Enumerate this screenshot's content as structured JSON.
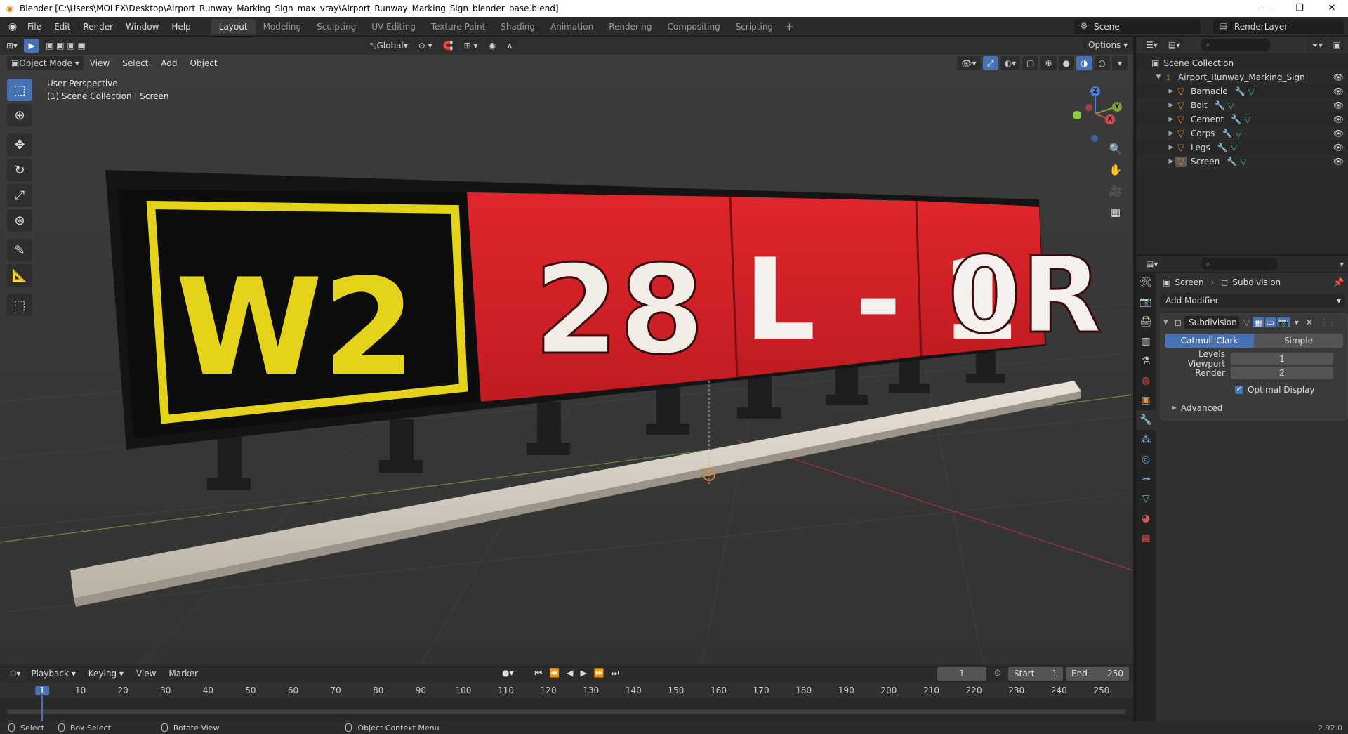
{
  "window": {
    "title": "Blender [C:\\Users\\MOLEX\\Desktop\\Airport_Runway_Marking_Sign_max_vray\\Airport_Runway_Marking_Sign_blender_base.blend]",
    "minimize": "—",
    "maximize": "❐",
    "close": "✕"
  },
  "menubar": {
    "items": [
      "File",
      "Edit",
      "Render",
      "Window",
      "Help"
    ],
    "workspaces": [
      "Layout",
      "Modeling",
      "Sculpting",
      "UV Editing",
      "Texture Paint",
      "Shading",
      "Animation",
      "Rendering",
      "Compositing",
      "Scripting"
    ],
    "add_workspace": "+",
    "scene": "Scene",
    "render_layer": "RenderLayer"
  },
  "viewport": {
    "transform_orientation": "Global",
    "options": "Options",
    "mode": "Object Mode",
    "menus": [
      "View",
      "Select",
      "Add",
      "Object"
    ],
    "info_line1": "User Perspective",
    "info_line2": "(1) Scene Collection | Screen",
    "sign_panels": [
      "W2",
      "28",
      "L - 1",
      "0R"
    ],
    "gizmo_axes": {
      "x": "X",
      "y": "Y",
      "z": "Z"
    }
  },
  "timeline": {
    "menus": [
      "Playback",
      "Keying",
      "View",
      "Marker"
    ],
    "current_frame": "1",
    "start_label": "Start",
    "start": "1",
    "end_label": "End",
    "end": "250",
    "ticks": [
      "1",
      "10",
      "20",
      "30",
      "40",
      "50",
      "60",
      "70",
      "80",
      "90",
      "100",
      "110",
      "120",
      "130",
      "140",
      "150",
      "160",
      "170",
      "180",
      "190",
      "200",
      "210",
      "220",
      "230",
      "240",
      "250"
    ]
  },
  "statusbar": {
    "select": "Select",
    "box_select": "Box Select",
    "rotate_view": "Rotate View",
    "context_menu": "Object Context Menu",
    "version": "2.92.0"
  },
  "outliner": {
    "root": "Scene Collection",
    "collection": "Airport_Runway_Marking_Sign",
    "objects": [
      "Barnacle",
      "Bolt",
      "Cement",
      "Corps",
      "Legs",
      "Screen"
    ]
  },
  "properties": {
    "object": "Screen",
    "modifier_crumb": "Subdivision",
    "add_modifier": "Add Modifier",
    "modifier_name": "Subdivision",
    "method_on": "Catmull-Clark",
    "method_off": "Simple",
    "levels_viewport_label": "Levels Viewport",
    "levels_viewport": "1",
    "render_label": "Render",
    "render": "2",
    "optimal_display": "Optimal Display",
    "advanced": "Advanced"
  },
  "colors": {
    "accent": "#4772b3",
    "sign_red": "#d42027",
    "sign_yellow": "#e4d21b",
    "object_orange": "#e69138"
  }
}
